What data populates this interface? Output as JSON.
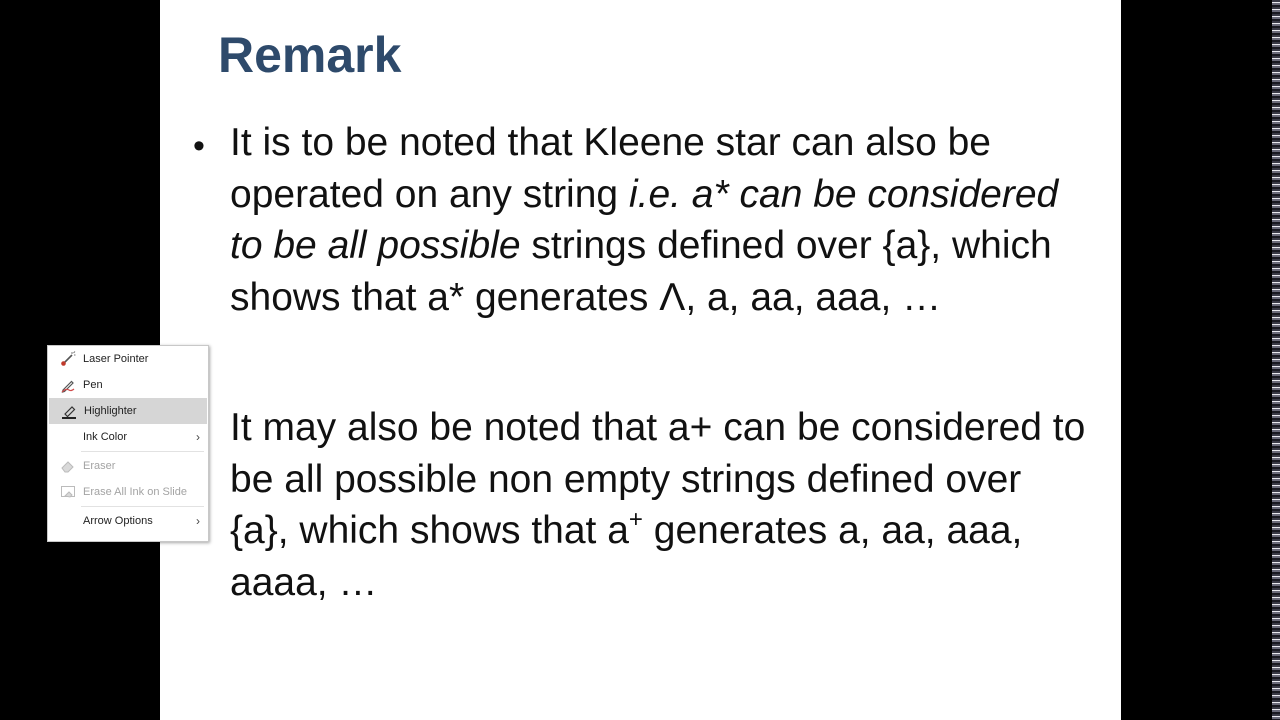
{
  "slide": {
    "title": "Remark",
    "bullet": "•",
    "para1": {
      "t1": "It is to be noted that Kleene star can also be operated on any string ",
      "t2": "i.e. a* can be considered to be all possible",
      "t3": " strings defined over {a}, which shows that a* generates Λ, a, aa, aaa, …"
    },
    "para2": {
      "t1": "It may also be noted that a+ can be considered to be all possible non empty strings defined over {a}, which shows that a",
      "sup": "+",
      "t2": " generates a, aa, aaa, aaaa, …"
    }
  },
  "context_menu": {
    "items": [
      {
        "label": "Laser Pointer",
        "icon": "laser-pointer-icon"
      },
      {
        "label": "Pen",
        "icon": "pen-icon"
      },
      {
        "label": "Highlighter",
        "icon": "highlighter-icon"
      },
      {
        "label": "Ink Color",
        "icon": "chevron-right-icon"
      },
      {
        "label": "Eraser",
        "icon": "eraser-icon"
      },
      {
        "label": "Erase All Ink on Slide",
        "icon": "erase-all-ink-icon"
      },
      {
        "label": "Arrow Options",
        "icon": "chevron-right-icon"
      }
    ],
    "arrow_glyph": "›"
  },
  "colors": {
    "title": "#2e4a6b",
    "laser": "#c0392b",
    "pen": "#d04a4a",
    "highlight_bg": "#d6d6d6"
  }
}
